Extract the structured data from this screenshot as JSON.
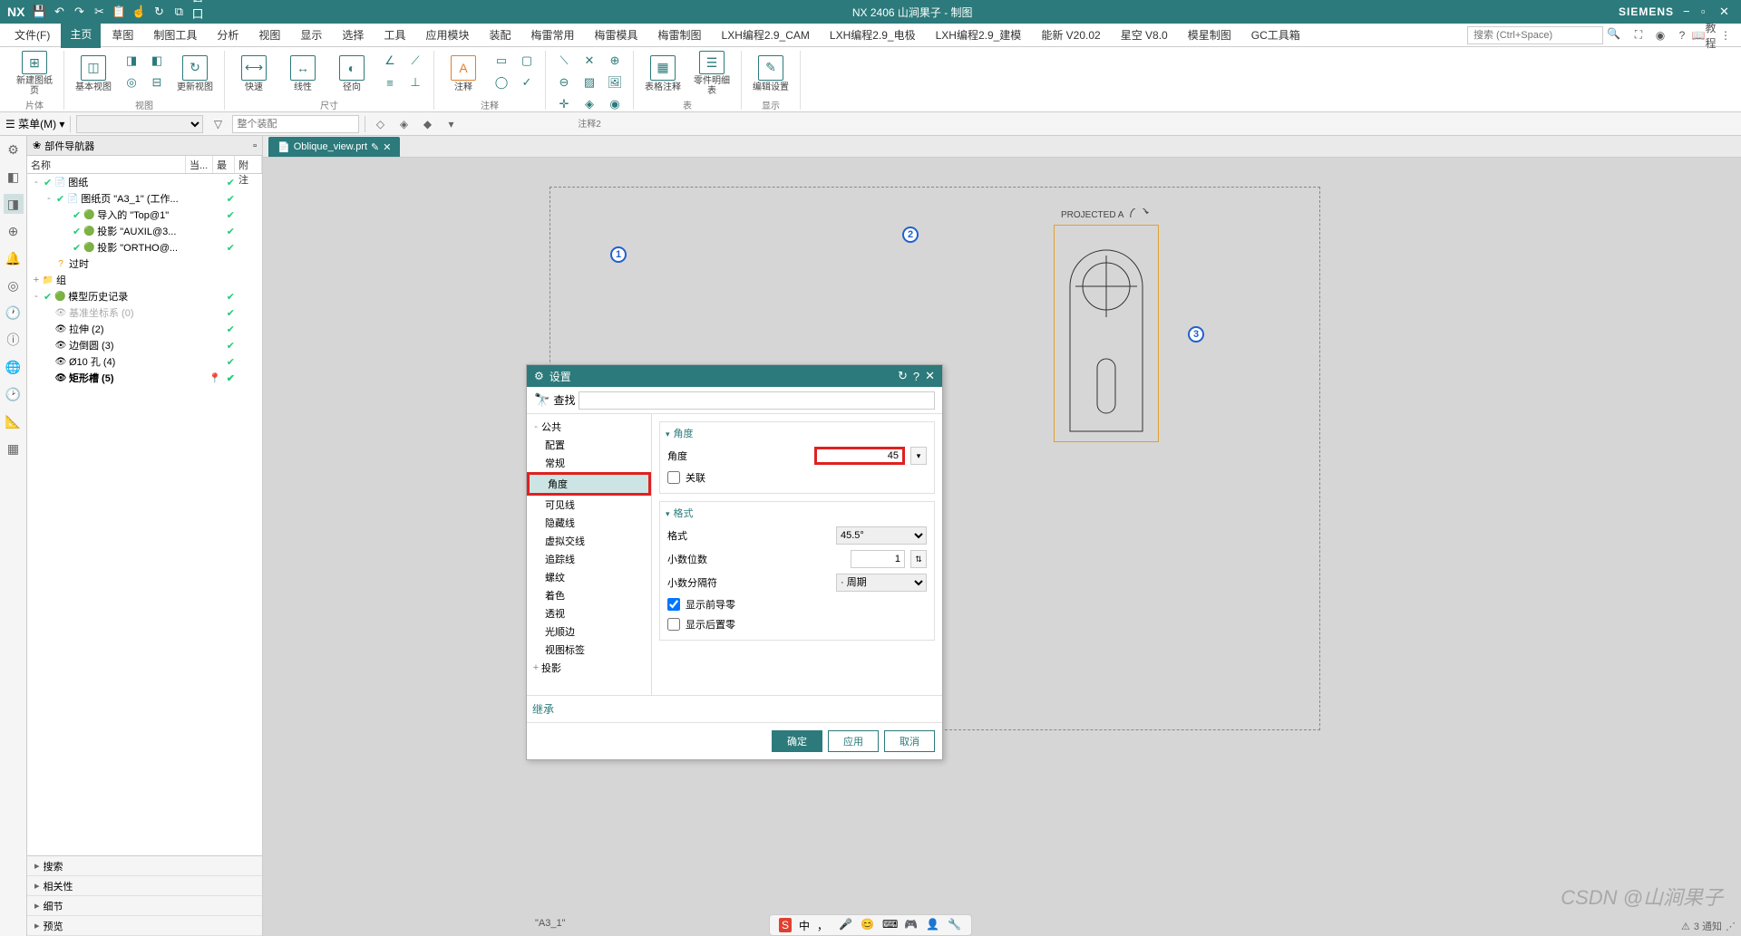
{
  "app": {
    "logo": "NX",
    "title": "NX 2406 山涧果子 - 制图",
    "brand": "SIEMENS"
  },
  "qat_dropdown": "窗口▾",
  "menus": {
    "items": [
      "文件(F)",
      "主页",
      "草图",
      "制图工具",
      "分析",
      "视图",
      "显示",
      "选择",
      "工具",
      "应用模块",
      "装配",
      "梅雷常用",
      "梅雷模具",
      "梅雷制图",
      "LXH编程2.9_CAM",
      "LXH编程2.9_电极",
      "LXH编程2.9_建模",
      "能新 V20.02",
      "星空 V8.0",
      "模星制图",
      "GC工具箱"
    ],
    "search_placeholder": "搜索 (Ctrl+Space)",
    "tutorial": "教程"
  },
  "ribbon": {
    "groups": [
      {
        "label": "片体",
        "large": [
          "新建图纸页"
        ]
      },
      {
        "label": "视图",
        "large": [
          "基本视图",
          "",
          "更新视图"
        ],
        "med": [
          "快速",
          "线性",
          "径向"
        ]
      },
      {
        "label": "尺寸",
        "large": [
          "快速",
          "线性",
          "径向"
        ]
      },
      {
        "label": "注释",
        "large": [
          "注释"
        ]
      },
      {
        "label": "注释2"
      },
      {
        "label": "表",
        "large": [
          "表格注释",
          "零件明细表"
        ]
      },
      {
        "label": "显示",
        "large": [
          "编辑设置"
        ]
      }
    ]
  },
  "subtoolbar": {
    "menu_label": "菜单(M)",
    "assembly_placeholder": "整个装配"
  },
  "leftbar_icons": [
    "gear",
    "cube",
    "block",
    "target",
    "bell",
    "clock",
    "filter",
    "wrench",
    "clock2",
    "grid",
    "measure",
    "palette"
  ],
  "navigator": {
    "title": "部件导航器",
    "cols": [
      "名称",
      "当...",
      "最",
      "附注"
    ],
    "tree": [
      {
        "lvl": 0,
        "exp": "-",
        "icon": "📄",
        "label": "图纸",
        "chk": true,
        "chk2": true
      },
      {
        "lvl": 1,
        "exp": "-",
        "icon": "📄",
        "label": "图纸页 \"A3_1\" (工作...",
        "chk": true,
        "chk2": true
      },
      {
        "lvl": 2,
        "exp": "",
        "icon": "🟢",
        "label": "导入的 \"Top@1\"",
        "chk": true,
        "chk2": true
      },
      {
        "lvl": 2,
        "exp": "",
        "icon": "🟢",
        "label": "投影 \"AUXIL@3...",
        "chk": true,
        "chk2": true
      },
      {
        "lvl": 2,
        "exp": "",
        "icon": "🟢",
        "label": "投影 \"ORTHO@...",
        "chk": true,
        "chk2": true
      },
      {
        "lvl": 0,
        "exp": "",
        "icon": "?",
        "label": "过时",
        "chk": false
      },
      {
        "lvl": 0,
        "exp": "+",
        "icon": "📁",
        "label": "组",
        "chk": false
      },
      {
        "lvl": 0,
        "exp": "-",
        "icon": "🟢",
        "label": "模型历史记录",
        "chk": true,
        "chk2": true
      },
      {
        "lvl": 1,
        "exp": "",
        "icon": "👁",
        "label": "基准坐标系 (0)",
        "muted": true,
        "chk2": true
      },
      {
        "lvl": 1,
        "exp": "",
        "icon": "👁",
        "label": "拉伸 (2)",
        "chk2": true
      },
      {
        "lvl": 1,
        "exp": "",
        "icon": "👁",
        "label": "边倒圆 (3)",
        "chk2": true
      },
      {
        "lvl": 1,
        "exp": "",
        "icon": "👁",
        "label": "Ø10 孔 (4)",
        "chk2": true
      },
      {
        "lvl": 1,
        "exp": "",
        "icon": "👁",
        "label": "矩形槽 (5)",
        "bold": true,
        "chk2": true,
        "current": true
      }
    ],
    "accordion": [
      "搜索",
      "相关性",
      "细节",
      "预览"
    ]
  },
  "tab": {
    "label": "Oblique_view.prt",
    "modified": true
  },
  "sheet_corner": "\"A3_1\"",
  "projected": "PROJECTED  A",
  "dialog": {
    "title": "设置",
    "search_label": "查找",
    "tree": [
      {
        "lvl": 0,
        "exp": "-",
        "label": "公共"
      },
      {
        "lvl": 1,
        "label": "配置"
      },
      {
        "lvl": 1,
        "label": "常规"
      },
      {
        "lvl": 1,
        "label": "角度",
        "selected": true
      },
      {
        "lvl": 1,
        "label": "可见线"
      },
      {
        "lvl": 1,
        "label": "隐藏线"
      },
      {
        "lvl": 1,
        "label": "虚拟交线"
      },
      {
        "lvl": 1,
        "label": "追踪线"
      },
      {
        "lvl": 1,
        "label": "螺纹"
      },
      {
        "lvl": 1,
        "label": "着色"
      },
      {
        "lvl": 1,
        "label": "透视"
      },
      {
        "lvl": 1,
        "label": "光顺边"
      },
      {
        "lvl": 1,
        "label": "视图标签"
      },
      {
        "lvl": 0,
        "exp": "+",
        "label": "投影"
      }
    ],
    "g_angle": "角度",
    "angle_label": "角度",
    "angle_value": "45",
    "assoc_label": "关联",
    "g_format": "格式",
    "format_label": "格式",
    "format_value": "45.5°",
    "decimals_label": "小数位数",
    "decimals_value": "1",
    "sep_label": "小数分隔符",
    "sep_value": "· 周期",
    "lead_zero_label": "显示前导零",
    "trail_zero_label": "显示后置零",
    "inherit_title": "继承",
    "btn_ok": "确定",
    "btn_apply": "应用",
    "btn_cancel": "取消"
  },
  "callouts": {
    "c1": "1",
    "c2": "2",
    "c3": "3"
  },
  "watermark": "CSDN @山涧果子",
  "status_notif": "3 通知",
  "ime": "中"
}
